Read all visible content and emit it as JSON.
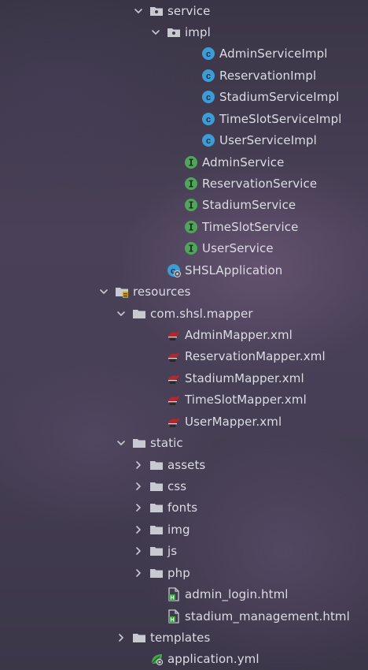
{
  "project_tree": {
    "items": [
      {
        "label": "service",
        "icon": "package-folder-icon",
        "expand": "expanded",
        "depth": 5
      },
      {
        "label": "impl",
        "icon": "package-folder-icon",
        "expand": "expanded",
        "depth": 6
      },
      {
        "label": "AdminServiceImpl",
        "icon": "class-icon",
        "expand": "none",
        "depth": 8
      },
      {
        "label": "ReservationImpl",
        "icon": "class-icon",
        "expand": "none",
        "depth": 8
      },
      {
        "label": "StadiumServiceImpl",
        "icon": "class-icon",
        "expand": "none",
        "depth": 8
      },
      {
        "label": "TimeSlotServiceImpl",
        "icon": "class-icon",
        "expand": "none",
        "depth": 8
      },
      {
        "label": "UserServiceImpl",
        "icon": "class-icon",
        "expand": "none",
        "depth": 8
      },
      {
        "label": "AdminService",
        "icon": "interface-icon",
        "expand": "none",
        "depth": 7
      },
      {
        "label": "ReservationService",
        "icon": "interface-icon",
        "expand": "none",
        "depth": 7
      },
      {
        "label": "StadiumService",
        "icon": "interface-icon",
        "expand": "none",
        "depth": 7
      },
      {
        "label": "TimeSlotService",
        "icon": "interface-icon",
        "expand": "none",
        "depth": 7
      },
      {
        "label": "UserService",
        "icon": "interface-icon",
        "expand": "none",
        "depth": 7
      },
      {
        "label": "SHSLApplication",
        "icon": "spring-boot-class-icon",
        "expand": "none",
        "depth": 6
      },
      {
        "label": "resources",
        "icon": "resources-folder-icon",
        "expand": "expanded",
        "depth": 3
      },
      {
        "label": "com.shsl.mapper",
        "icon": "folder-icon",
        "expand": "expanded",
        "depth": 4
      },
      {
        "label": "AdminMapper.xml",
        "icon": "mybatis-xml-icon",
        "expand": "none",
        "depth": 6
      },
      {
        "label": "ReservationMapper.xml",
        "icon": "mybatis-xml-icon",
        "expand": "none",
        "depth": 6
      },
      {
        "label": "StadiumMapper.xml",
        "icon": "mybatis-xml-icon",
        "expand": "none",
        "depth": 6
      },
      {
        "label": "TimeSlotMapper.xml",
        "icon": "mybatis-xml-icon",
        "expand": "none",
        "depth": 6
      },
      {
        "label": "UserMapper.xml",
        "icon": "mybatis-xml-icon",
        "expand": "none",
        "depth": 6
      },
      {
        "label": "static",
        "icon": "folder-icon",
        "expand": "expanded",
        "depth": 4
      },
      {
        "label": "assets",
        "icon": "folder-icon",
        "expand": "collapsed",
        "depth": 5
      },
      {
        "label": "css",
        "icon": "folder-icon",
        "expand": "collapsed",
        "depth": 5
      },
      {
        "label": "fonts",
        "icon": "folder-icon",
        "expand": "collapsed",
        "depth": 5
      },
      {
        "label": "img",
        "icon": "folder-icon",
        "expand": "collapsed",
        "depth": 5
      },
      {
        "label": "js",
        "icon": "folder-icon",
        "expand": "collapsed",
        "depth": 5
      },
      {
        "label": "php",
        "icon": "folder-icon",
        "expand": "collapsed",
        "depth": 5
      },
      {
        "label": "admin_login.html",
        "icon": "html-file-icon",
        "expand": "none",
        "depth": 6
      },
      {
        "label": "stadium_management.html",
        "icon": "html-file-icon",
        "expand": "none",
        "depth": 6
      },
      {
        "label": "templates",
        "icon": "folder-icon",
        "expand": "collapsed",
        "depth": 4
      },
      {
        "label": "application.yml",
        "icon": "spring-yml-icon",
        "expand": "none",
        "depth": 5
      }
    ]
  },
  "colors": {
    "class_icon": "#3d9bd6",
    "interface_icon": "#4fa65a",
    "folder_icon": "#c9c9d1",
    "text": "#dcdce4",
    "mybatis_red": "#b8252a",
    "html_green": "#41a84a"
  }
}
